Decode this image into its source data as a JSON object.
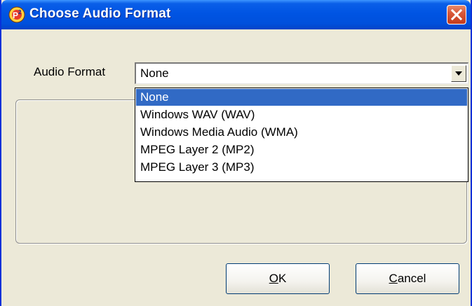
{
  "window": {
    "title": "Choose Audio Format",
    "close_glyph": "✕",
    "app_icon": "p2-app-icon"
  },
  "format": {
    "label": "Audio Format",
    "selected": "None",
    "options": [
      "None",
      "Windows WAV (WAV)",
      "Windows Media Audio (WMA)",
      "MPEG Layer 2 (MP2)",
      "MPEG Layer 3 (MP3)"
    ]
  },
  "buttons": {
    "ok_mnemonic": "O",
    "ok_rest": "K",
    "cancel_mnemonic": "C",
    "cancel_rest": "ancel"
  },
  "colors": {
    "titlebar": "#0054e3",
    "highlight": "#316ac5",
    "close": "#c43b1c",
    "face": "#ece9d8"
  }
}
